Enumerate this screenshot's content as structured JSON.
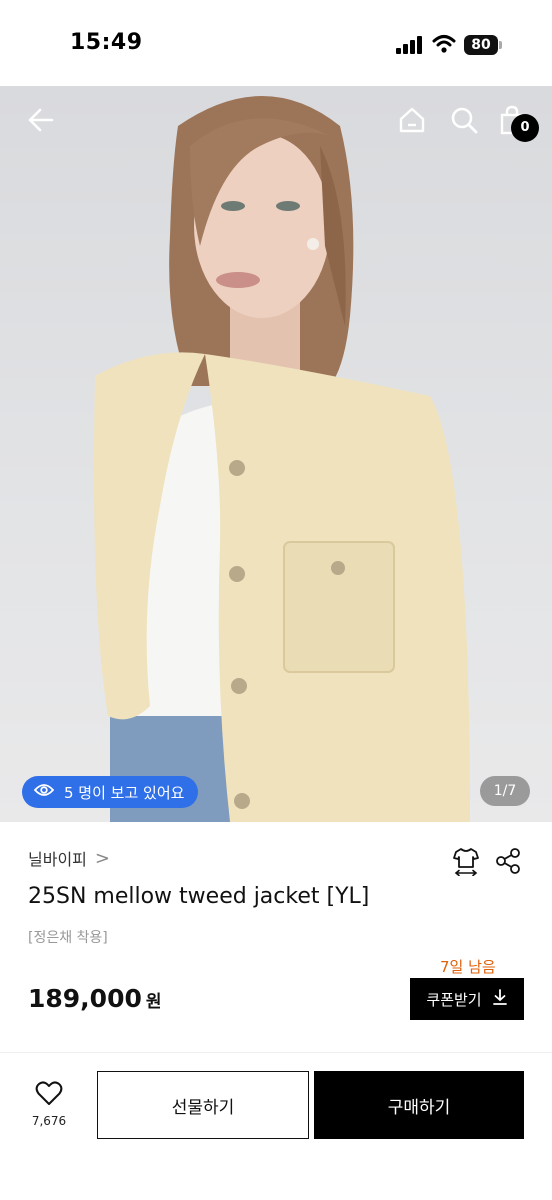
{
  "status_bar": {
    "time": "15:49",
    "battery_level": "80",
    "icons": [
      "signal-icon",
      "wifi-icon",
      "battery-icon"
    ]
  },
  "top_nav": {
    "icons": [
      "back-arrow-icon",
      "home-icon",
      "search-icon",
      "shopping-bag-icon"
    ],
    "cart_count": "0"
  },
  "hero": {
    "viewers_text": "5 명이 보고 있어요",
    "viewers_icon": "eye-icon",
    "page_indicator": "1/7",
    "colors": {
      "pill": "#2f6fe8"
    }
  },
  "product": {
    "brand": "닐바이피",
    "brand_chevron": ">",
    "title": "25SN mellow tweed jacket [YL]",
    "note": "[정은채 착용]",
    "remaining": "7일 남음",
    "price": "189,000",
    "price_unit": "원",
    "coupon_label": "쿠폰받기",
    "action_icons": [
      "size-guide-icon",
      "share-icon"
    ],
    "colors": {
      "remaining": "#e0620c"
    }
  },
  "bottom_bar": {
    "like_count": "7,676",
    "gift_label": "선물하기",
    "buy_label": "구매하기"
  }
}
